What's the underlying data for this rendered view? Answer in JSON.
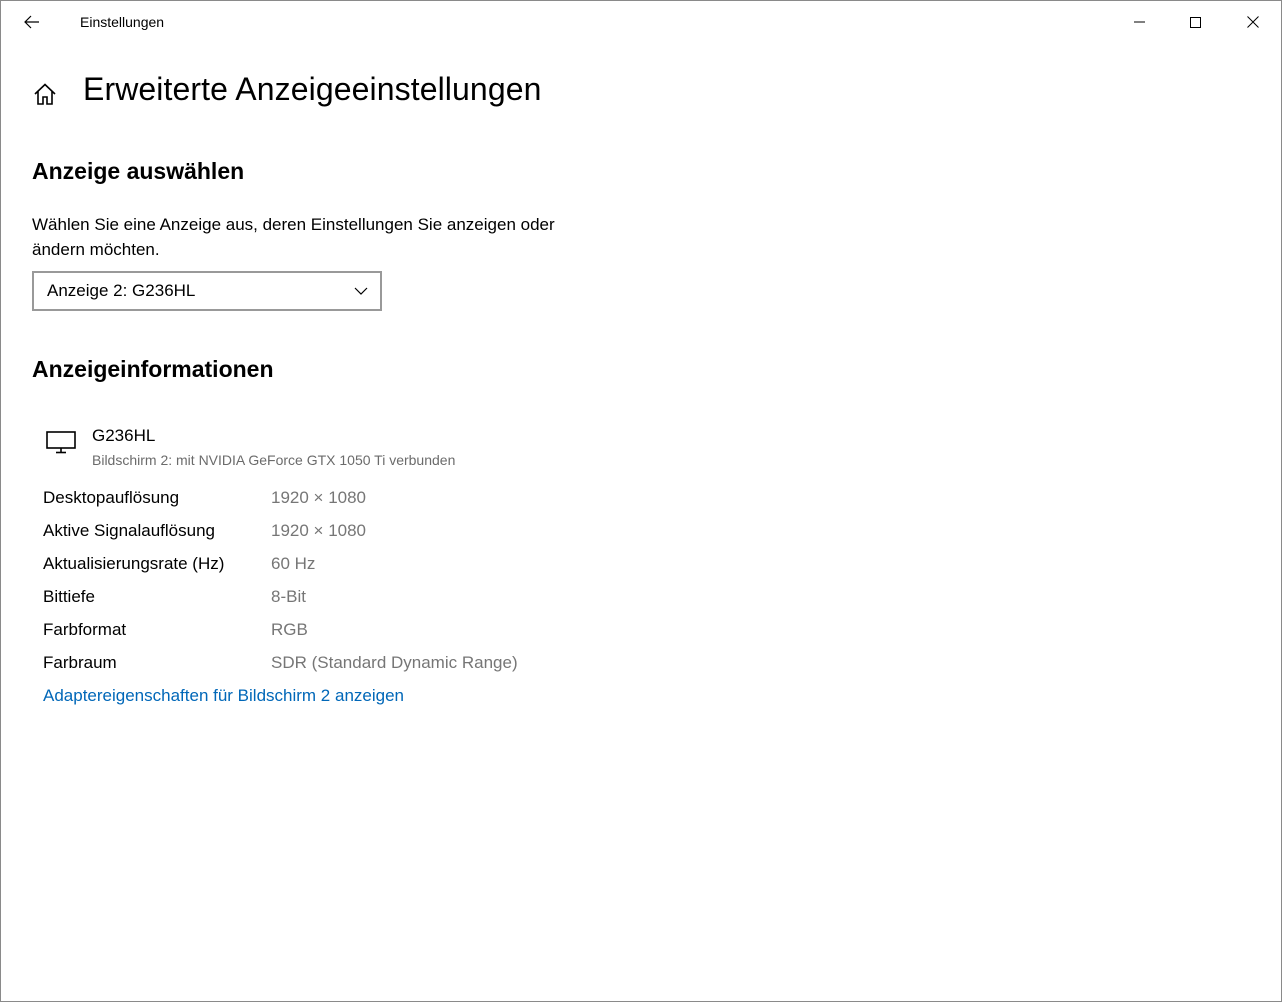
{
  "window": {
    "app_title": "Einstellungen",
    "icons": {
      "back": "back-arrow-icon",
      "minimize": "minimize-icon",
      "maximize": "maximize-icon",
      "close": "close-icon"
    }
  },
  "page": {
    "title": "Erweiterte Anzeigeeinstellungen",
    "home_icon": "home-icon"
  },
  "select_display": {
    "heading": "Anzeige auswählen",
    "description": "Wählen Sie eine Anzeige aus, deren Einstellungen Sie anzeigen oder ändern möchten.",
    "dropdown_value": "Anzeige 2: G236HL"
  },
  "display_info": {
    "heading": "Anzeigeinformationen",
    "monitor_name": "G236HL",
    "monitor_subtitle": "Bildschirm 2: mit NVIDIA GeForce GTX 1050 Ti verbunden",
    "rows": [
      {
        "label": "Desktopauflösung",
        "value": "1920 × 1080"
      },
      {
        "label": "Aktive Signalauflösung",
        "value": "1920 × 1080"
      },
      {
        "label": "Aktualisierungsrate (Hz)",
        "value": "60 Hz"
      },
      {
        "label": "Bittiefe",
        "value": "8-Bit"
      },
      {
        "label": "Farbformat",
        "value": "RGB"
      },
      {
        "label": "Farbraum",
        "value": "SDR (Standard Dynamic Range)"
      }
    ],
    "adapter_link": "Adaptereigenschaften für Bildschirm 2 anzeigen"
  },
  "colors": {
    "link": "#0067b8",
    "secondary_text": "#767676",
    "dropdown_border": "#999999"
  }
}
